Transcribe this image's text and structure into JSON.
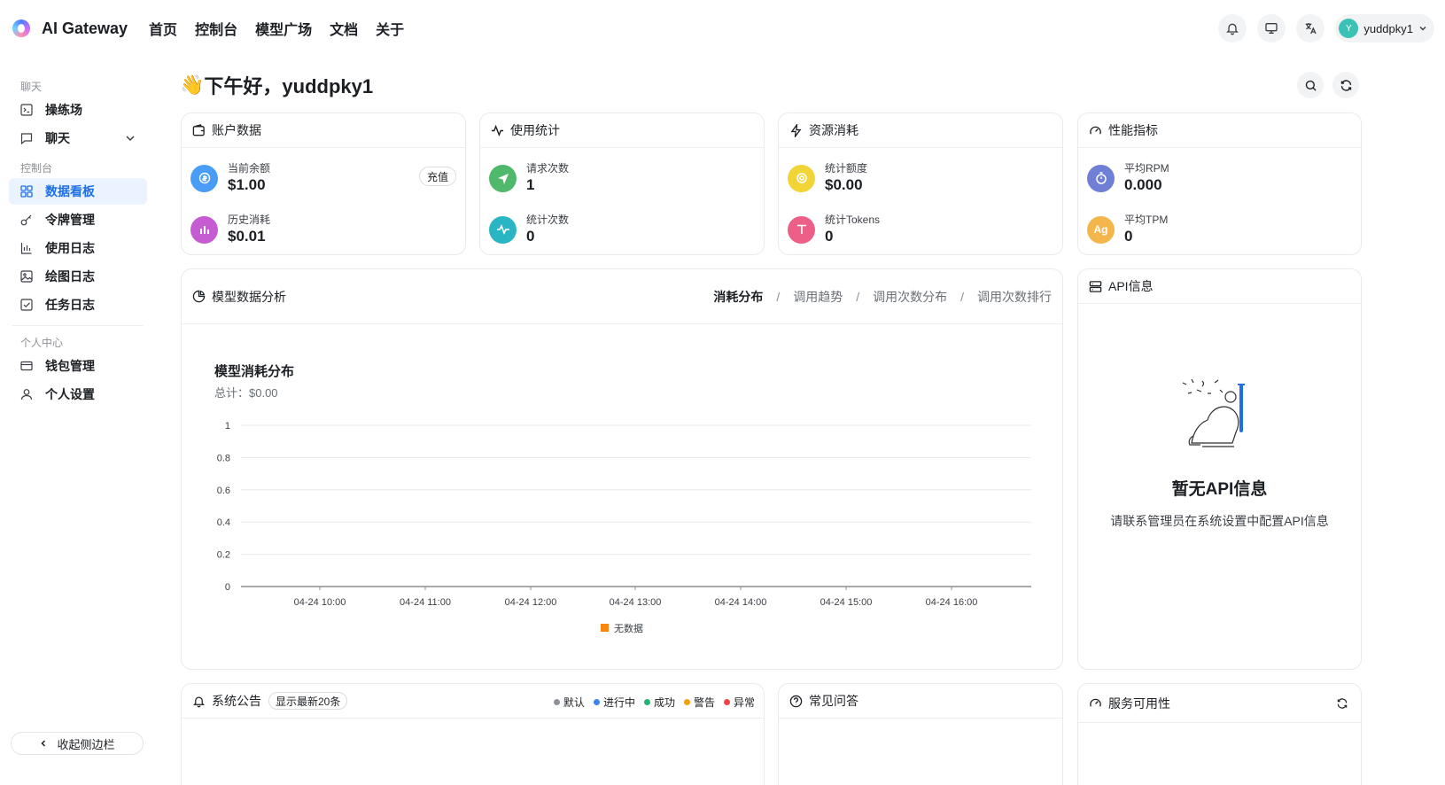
{
  "app": {
    "brand": "AI Gateway"
  },
  "nav": [
    "首页",
    "控制台",
    "模型广场",
    "文档",
    "关于"
  ],
  "user": {
    "avatar_letter": "Y",
    "name": "yuddpky1"
  },
  "sidebar": {
    "sections": {
      "chat": "聊天",
      "console": "控制台",
      "personal": "个人中心"
    },
    "chat_items": [
      {
        "label": "操练场",
        "icon": "terminal-icon"
      },
      {
        "label": "聊天",
        "icon": "chat-bubble-icon"
      }
    ],
    "console_items": [
      {
        "label": "数据看板",
        "icon": "dashboard-grid-icon",
        "active": true
      },
      {
        "label": "令牌管理",
        "icon": "key-icon"
      },
      {
        "label": "使用日志",
        "icon": "bar-chart-icon"
      },
      {
        "label": "绘图日志",
        "icon": "image-icon"
      },
      {
        "label": "任务日志",
        "icon": "checkbox-icon"
      }
    ],
    "personal_items": [
      {
        "label": "钱包管理",
        "icon": "wallet-icon"
      },
      {
        "label": "个人设置",
        "icon": "user-icon"
      }
    ],
    "collapse_label": "收起侧边栏"
  },
  "greeting": {
    "emoji": "👋",
    "text": "下午好，yuddpky1"
  },
  "cards": {
    "account": {
      "title": "账户数据",
      "recharge": "充值",
      "stats": [
        {
          "label": "当前余额",
          "value": "$1.00",
          "color": "#4a9df6"
        },
        {
          "label": "历史消耗",
          "value": "$0.01",
          "color": "#c65cd1"
        }
      ]
    },
    "usage": {
      "title": "使用统计",
      "stats": [
        {
          "label": "请求次数",
          "value": "1",
          "color": "#4fb86b"
        },
        {
          "label": "统计次数",
          "value": "0",
          "color": "#2ab5c4"
        }
      ]
    },
    "resource": {
      "title": "资源消耗",
      "stats": [
        {
          "label": "统计额度",
          "value": "$0.00",
          "color": "#f2d437"
        },
        {
          "label": "统计Tokens",
          "value": "0",
          "color": "#ec5f86"
        }
      ]
    },
    "performance": {
      "title": "性能指标",
      "stats": [
        {
          "label": "平均RPM",
          "value": "0.000",
          "color": "#6f7fd6"
        },
        {
          "label": "平均TPM",
          "value": "0",
          "color": "#f4b64a",
          "icon_text": "Ag"
        }
      ]
    }
  },
  "analysis": {
    "title": "模型数据分析",
    "tabs": [
      "消耗分布",
      "调用趋势",
      "调用次数分布",
      "调用次数排行"
    ],
    "active_tab": 0,
    "chart_title": "模型消耗分布",
    "chart_subtitle": "总计：$0.00"
  },
  "chart_data": {
    "type": "bar",
    "title": "模型消耗分布",
    "x": [
      "04-24 10:00",
      "04-24 11:00",
      "04-24 12:00",
      "04-24 13:00",
      "04-24 14:00",
      "04-24 15:00",
      "04-24 16:00"
    ],
    "y_ticks": [
      0,
      0.2,
      0.4,
      0.6,
      0.8,
      1
    ],
    "ylim": [
      0,
      1
    ],
    "series": [
      {
        "name": "无数据",
        "values": [
          0,
          0,
          0,
          0,
          0,
          0,
          0
        ],
        "color": "#f7860f"
      }
    ],
    "grid": true,
    "legend": "bottom"
  },
  "api_info": {
    "title": "API信息",
    "empty_title": "暂无API信息",
    "empty_desc": "请联系管理员在系统设置中配置API信息"
  },
  "notice": {
    "title": "系统公告",
    "badge": "显示最新20条",
    "legend": [
      {
        "label": "默认",
        "color": "#8d9199"
      },
      {
        "label": "进行中",
        "color": "#3b82f6"
      },
      {
        "label": "成功",
        "color": "#22b573"
      },
      {
        "label": "警告",
        "color": "#f59e0b"
      },
      {
        "label": "异常",
        "color": "#ef4444"
      }
    ]
  },
  "faq": {
    "title": "常见问答"
  },
  "service": {
    "title": "服务可用性"
  }
}
